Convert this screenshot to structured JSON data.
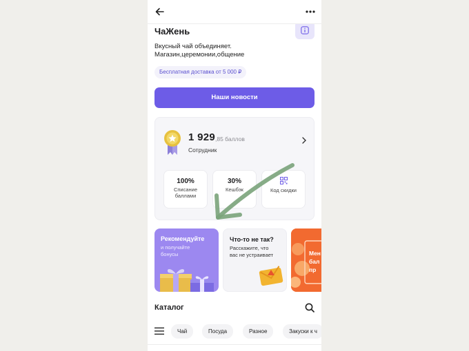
{
  "header": {
    "back_icon": "arrow-left-icon",
    "more_icon": "more-dots-icon"
  },
  "shop": {
    "name": "ЧаЖень",
    "description_line1": "Вкусный чай объединяет.",
    "description_line2": "Магазин,церемонии,общение",
    "delivery_chip": "Бесплатная доставка от 5 000 ₽",
    "info_icon": "info-icon"
  },
  "news_button": "Наши новости",
  "loyalty": {
    "points_value": "1 929",
    "points_unit": ",85 баллов",
    "status": "Сотрудник",
    "medal_icon": "medal-star-icon",
    "colors": {
      "medal": "#e7c13f",
      "ribbon": "#8c7fd8"
    },
    "tiles": [
      {
        "big": "100%",
        "small1": "Списание",
        "small2": "баллами"
      },
      {
        "big": "30%",
        "small1": "Кешбэк",
        "small2": ""
      },
      {
        "icon": "qr-code-icon",
        "small1": "Код скидки"
      }
    ]
  },
  "promos": [
    {
      "title": "Рекомендуйте",
      "text1": "и получайте",
      "text2": "бонусы",
      "color": "#9c88f0"
    },
    {
      "title": "Что-то не так?",
      "text1": "Расскажите, что",
      "text2": "вас не устраивает",
      "color": "#f4f4f7"
    },
    {
      "title1": "Мен",
      "title2": "бал",
      "title3": "пр",
      "color": "#f26a30"
    }
  ],
  "catalog": {
    "title": "Каталог",
    "search_icon": "search-icon",
    "menu_icon": "hamburger-icon",
    "categories": [
      "Чай",
      "Посуда",
      "Разное",
      "Закуски к ч"
    ]
  },
  "accent_color": "#6d5ce7",
  "annotation_arrow_color": "#7aa37a"
}
